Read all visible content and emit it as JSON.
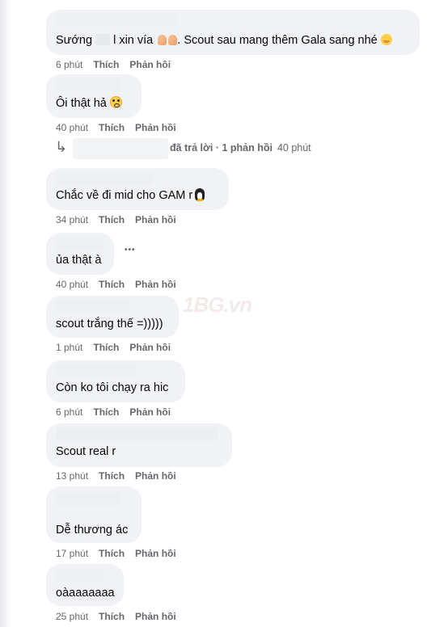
{
  "comments": [
    {
      "text_before": "Sướng",
      "text_mid": "l xin vía",
      "text_after": ". Scout sau mang thêm Gala sang nhé",
      "time": "6 phút",
      "like": "Thích",
      "reply": "Phản hồi"
    },
    {
      "text": "Ôi thật hả",
      "time": "40 phút",
      "like": "Thích",
      "reply": "Phản hồi"
    },
    {
      "text": "Chắc về đi mid cho GAM r",
      "time": "34 phút",
      "like": "Thích",
      "reply": "Phản hồi"
    },
    {
      "text": "ủa thật à",
      "time": "40 phút",
      "like": "Thích",
      "reply": "Phản hồi",
      "more": "•••"
    },
    {
      "text": "scout trắng thế =)))))",
      "time": "1 phút",
      "like": "Thích",
      "reply": "Phản hồi"
    },
    {
      "text": "Còn ko tôi chạy ra hic",
      "time": "6 phút",
      "like": "Thích",
      "reply": "Phản hồi"
    },
    {
      "text": "Scout real r",
      "time": "13 phút",
      "like": "Thích",
      "reply": "Phản hồi"
    },
    {
      "text": "Dễ thương ác",
      "time": "17 phút",
      "like": "Thích",
      "reply": "Phản hồi"
    },
    {
      "text": "oàaaaaaaa",
      "time": "25 phút",
      "like": "Thích",
      "reply": "Phản hồi"
    }
  ],
  "reply_summary": {
    "text": "đã trả lời · 1 phản hồi",
    "time": "40 phút"
  },
  "watermark": "1BG.vn"
}
